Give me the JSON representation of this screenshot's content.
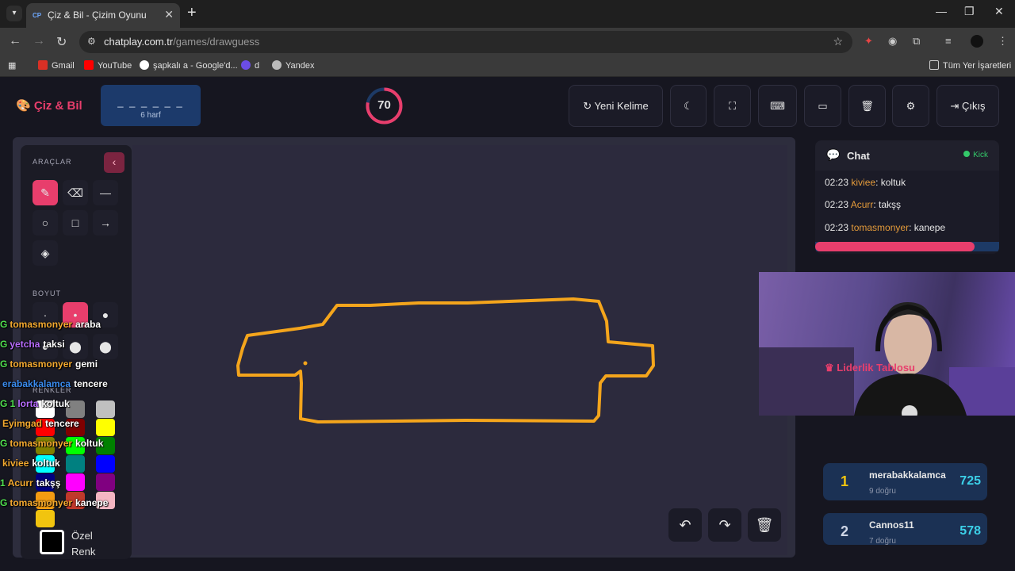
{
  "browser": {
    "tab_title": "Çiz & Bil - Çizim Oyunu",
    "tab_favicon": "CP",
    "url_host": "chatplay.com.tr",
    "url_path": "/games/drawguess",
    "bookmarks": [
      "Gmail",
      "YouTube",
      "şapkalı a - Google'd...",
      "d",
      "Yandex"
    ],
    "all_bookmarks": "Tüm Yer İşaretleri"
  },
  "app": {
    "logo": "Çiz & Bil",
    "word_mask": "_ _ _ _ _ _",
    "word_hint": "6 harf",
    "timer": "70",
    "timer_fraction": 0.78,
    "buttons": {
      "new_word": "Yeni Kelime",
      "exit": "Çıkış"
    }
  },
  "tools": {
    "section_tools": "ARAÇLAR",
    "section_size": "BOYUT",
    "section_colors": "RENKLER",
    "custom_color_line1": "Özel",
    "custom_color_line2": "Renk"
  },
  "colors": [
    "#ffffff",
    "#808080",
    "#c0c0c0",
    "#ff0000",
    "#800000",
    "#ffff00",
    "#808000",
    "#00ff00",
    "#008000",
    "#00ffff",
    "#008080",
    "#0000ff",
    "#000080",
    "#ff00ff",
    "#800080",
    "#f39c12",
    "#c0392b",
    "#f4b6c2",
    "#f1c40f"
  ],
  "overlay_chat": [
    {
      "badge": "G",
      "user": "tomasmonyer",
      "msg": "araba"
    },
    {
      "badge": "G",
      "user": "yetcha",
      "msg": "taksi"
    },
    {
      "badge": "G",
      "user": "tomasmonyer",
      "msg": "gemi"
    },
    {
      "badge": "",
      "user": "erabakkalamca",
      "msg": "tencere"
    },
    {
      "badge": "G 1",
      "user": "lorta",
      "msg": "koltuk"
    },
    {
      "badge": "",
      "user": "Eyimgad",
      "msg": "tencere"
    },
    {
      "badge": "G",
      "user": "tomasmonyer",
      "msg": "koltuk"
    },
    {
      "badge": "",
      "user": "kiviee",
      "msg": "koltuk"
    },
    {
      "badge": "1",
      "user": "Acurr",
      "msg": "takşş"
    },
    {
      "badge": "G",
      "user": "tomasmonyer",
      "msg": "kanepe"
    }
  ],
  "chat": {
    "title": "Chat",
    "kick_label": "Kick",
    "messages": [
      {
        "time": "02:23",
        "user": "kiviee",
        "text": "koltuk"
      },
      {
        "time": "02:23",
        "user": "Acurr",
        "text": "takşş"
      },
      {
        "time": "02:23",
        "user": "tomasmonyer",
        "text": "kanepe"
      }
    ]
  },
  "leaderboard": {
    "title": "Liderlik Tablosu",
    "rows": [
      {
        "rank": "1",
        "name": "merabakkalamca",
        "sub": "9 doğru",
        "score": "725"
      },
      {
        "rank": "2",
        "name": "Cannos11",
        "sub": "7 doğru",
        "score": "578"
      }
    ]
  }
}
